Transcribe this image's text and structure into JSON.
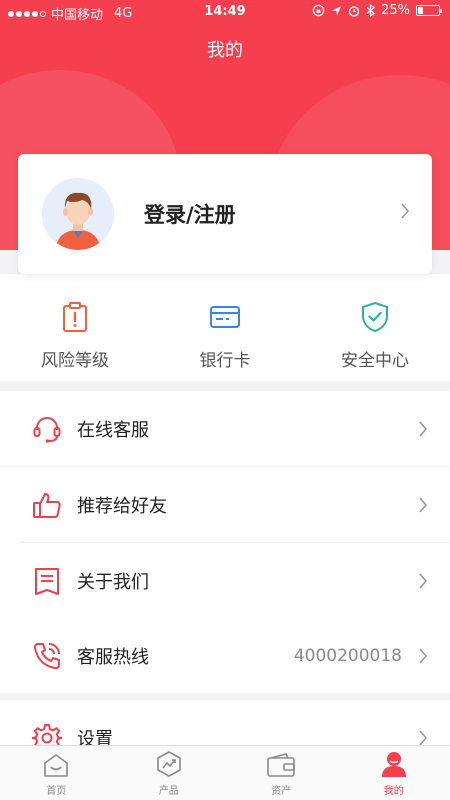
{
  "status_bar": {
    "carrier": "中国移动",
    "network": "4G",
    "time": "14:49",
    "battery": "25%",
    "battery_level": 0.25
  },
  "header": {
    "title": "我的"
  },
  "profile": {
    "login_label": "登录/注册"
  },
  "quick_actions": [
    {
      "label": "风险等级",
      "icon": "clipboard-alert-icon",
      "color": "#f0623f"
    },
    {
      "label": "银行卡",
      "icon": "bank-card-icon",
      "color": "#3f83e0"
    },
    {
      "label": "安全中心",
      "icon": "shield-check-icon",
      "color": "#2bb3a0"
    }
  ],
  "menu": {
    "online_service": {
      "label": "在线客服",
      "icon": "headset-icon"
    },
    "recommend": {
      "label": "推荐给好友",
      "icon": "thumbs-up-icon"
    },
    "about": {
      "label": "关于我们",
      "icon": "document-icon"
    },
    "hotline": {
      "label": "客服热线",
      "value": "4000200018",
      "icon": "phone-icon"
    },
    "settings": {
      "label": "设置",
      "icon": "gear-icon"
    }
  },
  "tabs": [
    {
      "label": "首页",
      "icon": "home-icon",
      "active": false
    },
    {
      "label": "产品",
      "icon": "product-icon",
      "active": false
    },
    {
      "label": "资产",
      "icon": "wallet-icon",
      "active": false
    },
    {
      "label": "我的",
      "icon": "user-icon",
      "active": true
    }
  ],
  "colors": {
    "brand": "#f53e4e",
    "icon_red": "#f0404e"
  }
}
